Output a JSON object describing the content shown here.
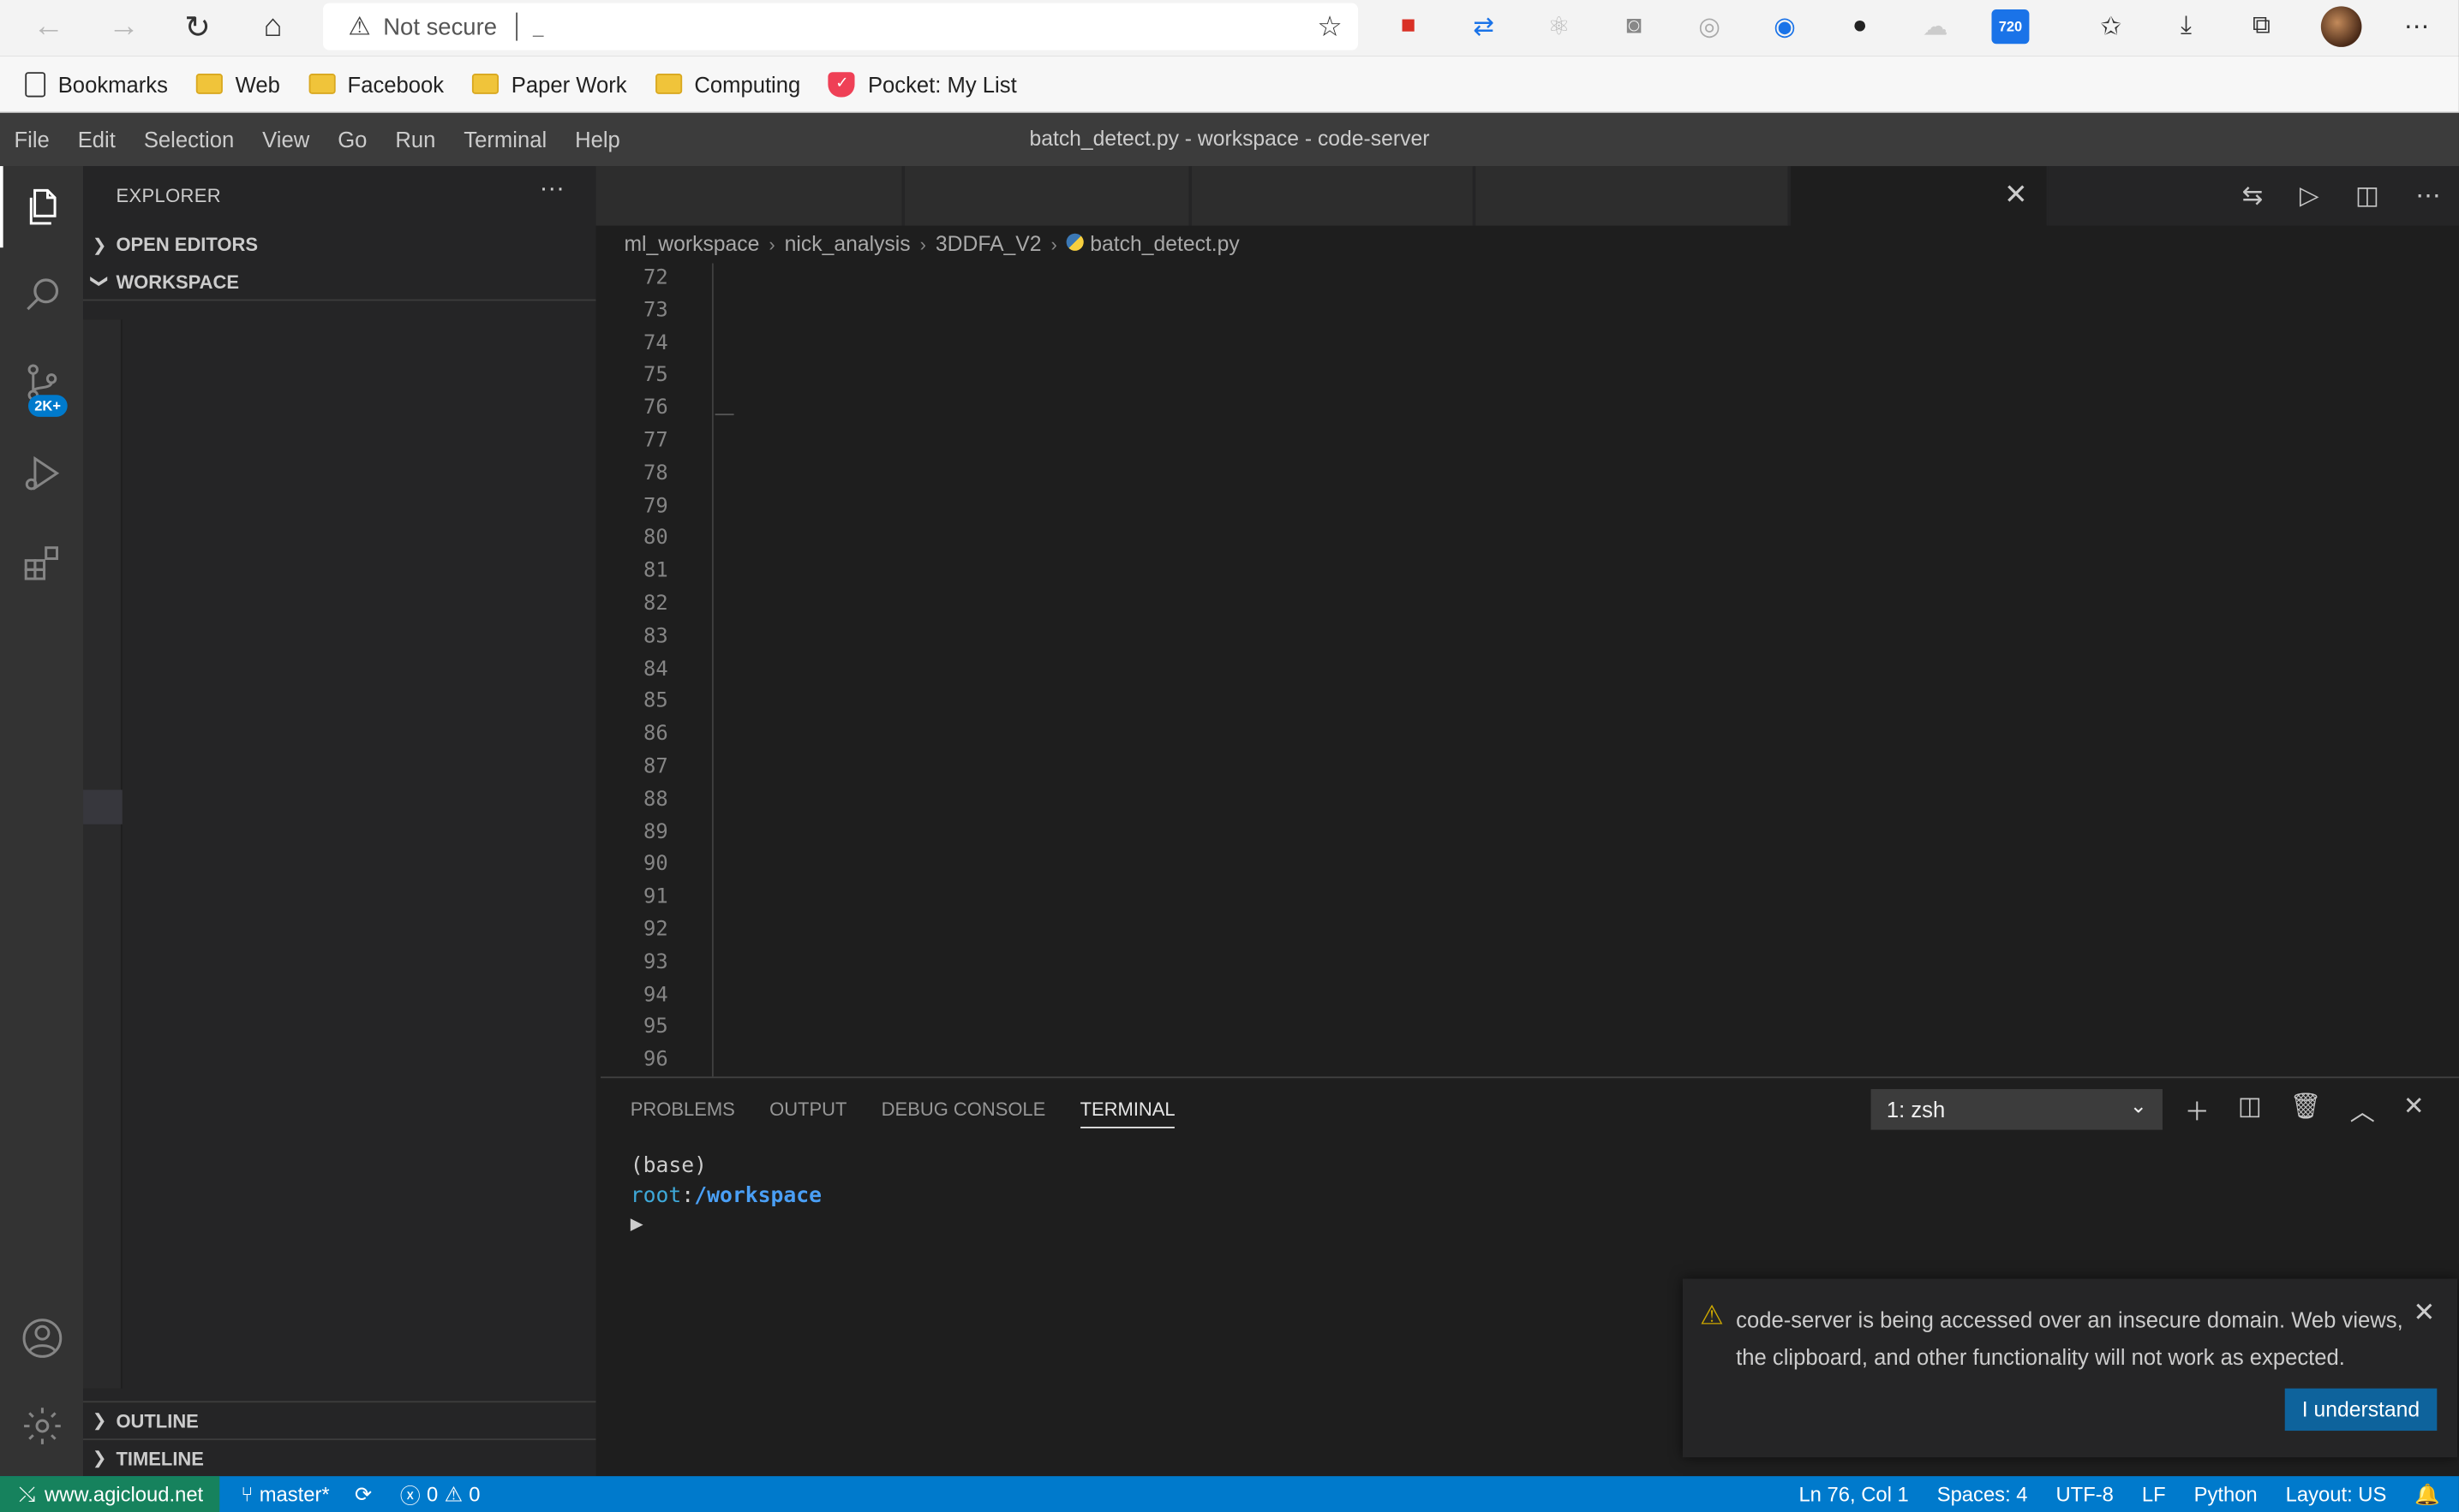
{
  "browser": {
    "address_warning": "Not secure",
    "address_url": "_",
    "bookmarks": [
      "Bookmarks",
      "Web",
      "Facebook",
      "Paper Work",
      "Computing",
      "Pocket: My List"
    ],
    "ext_badge": "720"
  },
  "vscode": {
    "menu": [
      "File",
      "Edit",
      "Selection",
      "View",
      "Go",
      "Run",
      "Terminal",
      "Help"
    ],
    "window_title": "batch_detect.py - workspace - code-server",
    "activity": {
      "scm_badge": "2K+"
    },
    "sidebar": {
      "title": "EXPLORER",
      "more": "···",
      "sections": {
        "open_editors": "OPEN EDITORS",
        "workspace": "WORKSPACE",
        "outline": "OUTLINE",
        "timeline": "TIMELINE"
      }
    },
    "breadcrumb": [
      "ml_workspace",
      "nick_analysis",
      "3DDFA_V2",
      "batch_detect.py"
    ],
    "line_numbers": [
      "72",
      "73",
      "74",
      "75",
      "76",
      "77",
      "78",
      "79",
      "80",
      "81",
      "82",
      "83",
      "84",
      "85",
      "86",
      "87",
      "88",
      "89",
      "90",
      "91",
      "92",
      "93",
      "94",
      "95",
      "96"
    ],
    "panel": {
      "tabs": [
        "PROBLEMS",
        "OUTPUT",
        "DEBUG CONSOLE",
        "TERMINAL"
      ],
      "active_tab": "TERMINAL",
      "terminal_select": "1: zsh",
      "terminal_lines": {
        "line1": "(base)",
        "user": "root",
        "colon": ":",
        "path": "/workspace",
        "prompt": "▶"
      }
    },
    "notification": {
      "message": "code-server is being accessed over an insecure domain. Web views, the clipboard, and other functionality will not work as expected.",
      "button": "I understand"
    },
    "status": {
      "remote": "www.agicloud.net",
      "branch": "master*",
      "errors": "0",
      "warnings": "0",
      "position": "Ln 76, Col 1",
      "spaces": "Spaces: 4",
      "encoding": "UTF-8",
      "eol": "LF",
      "language": "Python",
      "layout": "Layout: US"
    }
  },
  "colors": {
    "accent": "#007acc",
    "remote": "#16825d",
    "editor_bg": "#1e1e1e",
    "sidebar_bg": "#252526"
  }
}
